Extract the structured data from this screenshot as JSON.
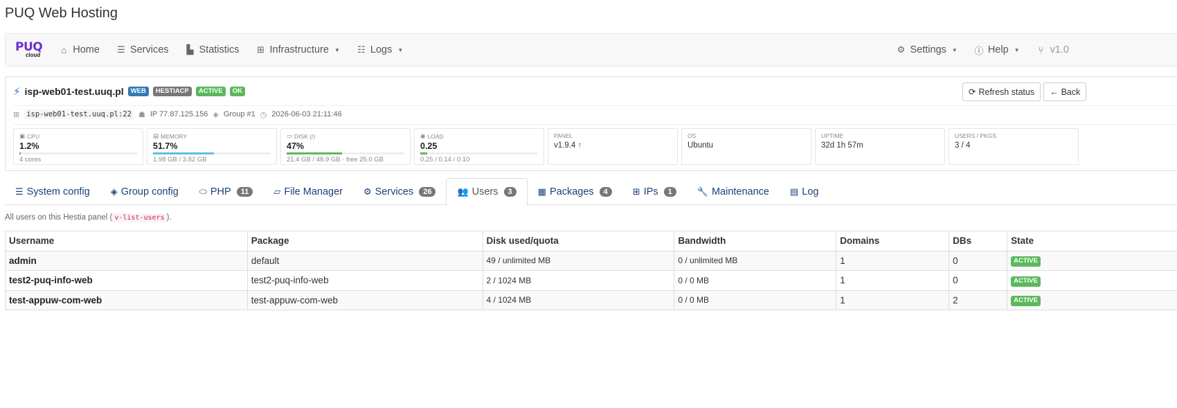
{
  "app": {
    "title": "PUQ Web Hosting"
  },
  "navbar": {
    "brand": {
      "name": "PUQ",
      "sub": "cloud"
    },
    "items": [
      {
        "label": "Home",
        "icon": "home-icon"
      },
      {
        "label": "Services",
        "icon": "list-icon"
      },
      {
        "label": "Statistics",
        "icon": "chart-icon"
      },
      {
        "label": "Infrastructure",
        "icon": "sitemap-icon"
      },
      {
        "label": "Logs",
        "icon": "checklist-icon"
      }
    ],
    "right": [
      {
        "label": "Settings",
        "icon": "gear-icon"
      },
      {
        "label": "Help",
        "icon": "info-icon"
      },
      {
        "label": "v1.0",
        "icon": "branch-icon"
      }
    ]
  },
  "host": {
    "name": "isp-web01-test.uuq.pl",
    "labels": [
      "WEB",
      "HESTIACP",
      "ACTIVE",
      "OK"
    ],
    "refresh_label": "Refresh status",
    "back_label": "Back",
    "meta": {
      "ssh": "isp-web01-test.uuq.pl:22",
      "ip": "IP 77.87.125.156",
      "group": "Group #1",
      "time": "2026-06-03 21:11:46"
    }
  },
  "stats": [
    {
      "caption": "CPU",
      "value": "1.2%",
      "sub": "4 cores",
      "bar": 0.012,
      "color": "#5cb85c"
    },
    {
      "caption": "MEMORY",
      "value": "51.7%",
      "sub": "1.98 GB / 3.82 GB",
      "bar": 0.517,
      "color": "#5bc0de"
    },
    {
      "caption": "DISK (/)",
      "value": "47%",
      "sub": "21.4 GB / 48.9 GB · free 25.0 GB",
      "bar": 0.47,
      "color": "#5cb85c"
    },
    {
      "caption": "LOAD",
      "value": "0.25",
      "sub": "0.25 / 0.14 / 0.10",
      "bar": 0.06,
      "color": "#5cb85c"
    },
    {
      "caption": "PANEL",
      "value": "v1.9.4"
    },
    {
      "caption": "OS",
      "value": "Ubuntu"
    },
    {
      "caption": "UPTIME",
      "value": "32d 1h 57m"
    },
    {
      "caption": "USERS / PKGS",
      "value": "3 / 4"
    }
  ],
  "tabs": [
    {
      "label": "System config",
      "icon": "sliders-icon"
    },
    {
      "label": "Group config",
      "icon": "layers-icon"
    },
    {
      "label": "PHP",
      "icon": "php-icon",
      "badge": "11"
    },
    {
      "label": "File Manager",
      "icon": "folder-icon"
    },
    {
      "label": "Services",
      "icon": "gears-icon",
      "badge": "26"
    },
    {
      "label": "Users",
      "icon": "users-icon",
      "badge": "3"
    },
    {
      "label": "Packages",
      "icon": "calendar-icon",
      "badge": "4"
    },
    {
      "label": "IPs",
      "icon": "network-icon",
      "badge": "1"
    },
    {
      "label": "Maintenance",
      "icon": "wrench-icon"
    },
    {
      "label": "Log",
      "icon": "list-alt-icon"
    }
  ],
  "hint": {
    "before": "All users on this Hestia panel (",
    "code": "v-list-users",
    "after": ")."
  },
  "table": {
    "headers": [
      "Username",
      "Package",
      "Disk used/quota",
      "Bandwidth",
      "Domains",
      "DBs",
      "State"
    ],
    "rows": [
      [
        "admin",
        "default",
        "49 / unlimited MB",
        "0 / unlimited MB",
        "1",
        "0",
        "ACTIVE"
      ],
      [
        "test2-puq-info-web",
        "test2-puq-info-web",
        "2 / 1024 MB",
        "0 / 0 MB",
        "1",
        "0",
        "ACTIVE"
      ],
      [
        "test-appuw-com-web",
        "test-appuw-com-web",
        "4 / 1024 MB",
        "0 / 0 MB",
        "1",
        "2",
        "ACTIVE"
      ]
    ]
  }
}
